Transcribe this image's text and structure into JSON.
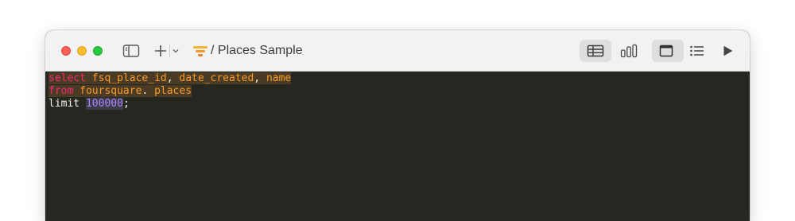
{
  "window": {
    "title": "/ Places Sample",
    "traffic_lights": {
      "close": "#fe5f57",
      "minimize": "#febc2e",
      "maximize": "#28c840"
    }
  },
  "toolbar": {
    "left_icons": [
      "sidebar-toggle-icon",
      "plus-icon",
      "chevron-down-icon",
      "funnel-icon"
    ],
    "right_icons": [
      "table-view-icon",
      "chart-view-icon",
      "editor-layout-icon",
      "list-icon",
      "run-icon"
    ],
    "active": [
      "table-view",
      "editor-layout"
    ]
  },
  "editor": {
    "lines": [
      [
        {
          "t": "select",
          "c": "kw"
        },
        {
          "t": " ",
          "c": "plain"
        },
        {
          "t": "fsq_place_id",
          "c": "id"
        },
        {
          "t": ", ",
          "c": "plain"
        },
        {
          "t": "date_created",
          "c": "id"
        },
        {
          "t": ", ",
          "c": "plain"
        },
        {
          "t": "name",
          "c": "id"
        }
      ],
      [
        {
          "t": "from",
          "c": "kw"
        },
        {
          "t": " ",
          "c": "plain"
        },
        {
          "t": "foursquare",
          "c": "id"
        },
        {
          "t": ". ",
          "c": "plain"
        },
        {
          "t": "places",
          "c": "id"
        }
      ],
      [
        {
          "t": "limit",
          "c": "plain"
        },
        {
          "t": " ",
          "c": "plain"
        },
        {
          "t": "100000",
          "c": "num"
        },
        {
          "t": ";",
          "c": "plain"
        }
      ]
    ],
    "colors": {
      "background": "#262721",
      "keyword": "#f92672",
      "identifier": "#fd9a2b",
      "number": "#ae81ff",
      "text": "#f8f8f2",
      "highlight": "#4a3c24"
    }
  }
}
